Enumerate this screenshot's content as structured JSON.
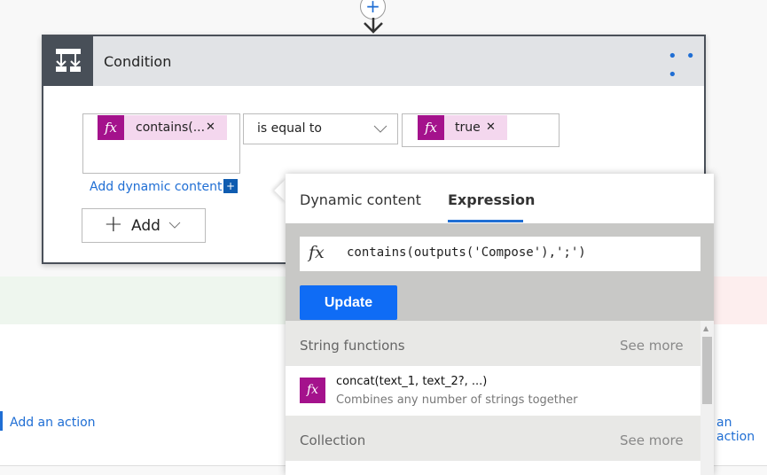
{
  "condition": {
    "title": "Condition",
    "more_label": "• • •",
    "left_token": "contains(...",
    "operator": "is equal to",
    "right_token": "true",
    "add_dynamic": "Add dynamic content",
    "add_label": "Add"
  },
  "popup": {
    "tabs": [
      {
        "label": "Dynamic content",
        "active": false
      },
      {
        "label": "Expression",
        "active": true
      }
    ],
    "expression": "contains(outputs('Compose'),';')",
    "update_label": "Update",
    "sections": [
      {
        "title": "String functions",
        "see_more": "See more"
      },
      {
        "title": "Collection",
        "see_more": "See more"
      }
    ],
    "item": {
      "name": "concat(text_1, text_2?, ...)",
      "desc": "Combines any number of strings together"
    }
  },
  "actions": {
    "left": "Add an action",
    "right": "an action"
  },
  "colors": {
    "accent": "#1f6ed4",
    "token": "#a4128c",
    "update": "#0f6cf5"
  }
}
